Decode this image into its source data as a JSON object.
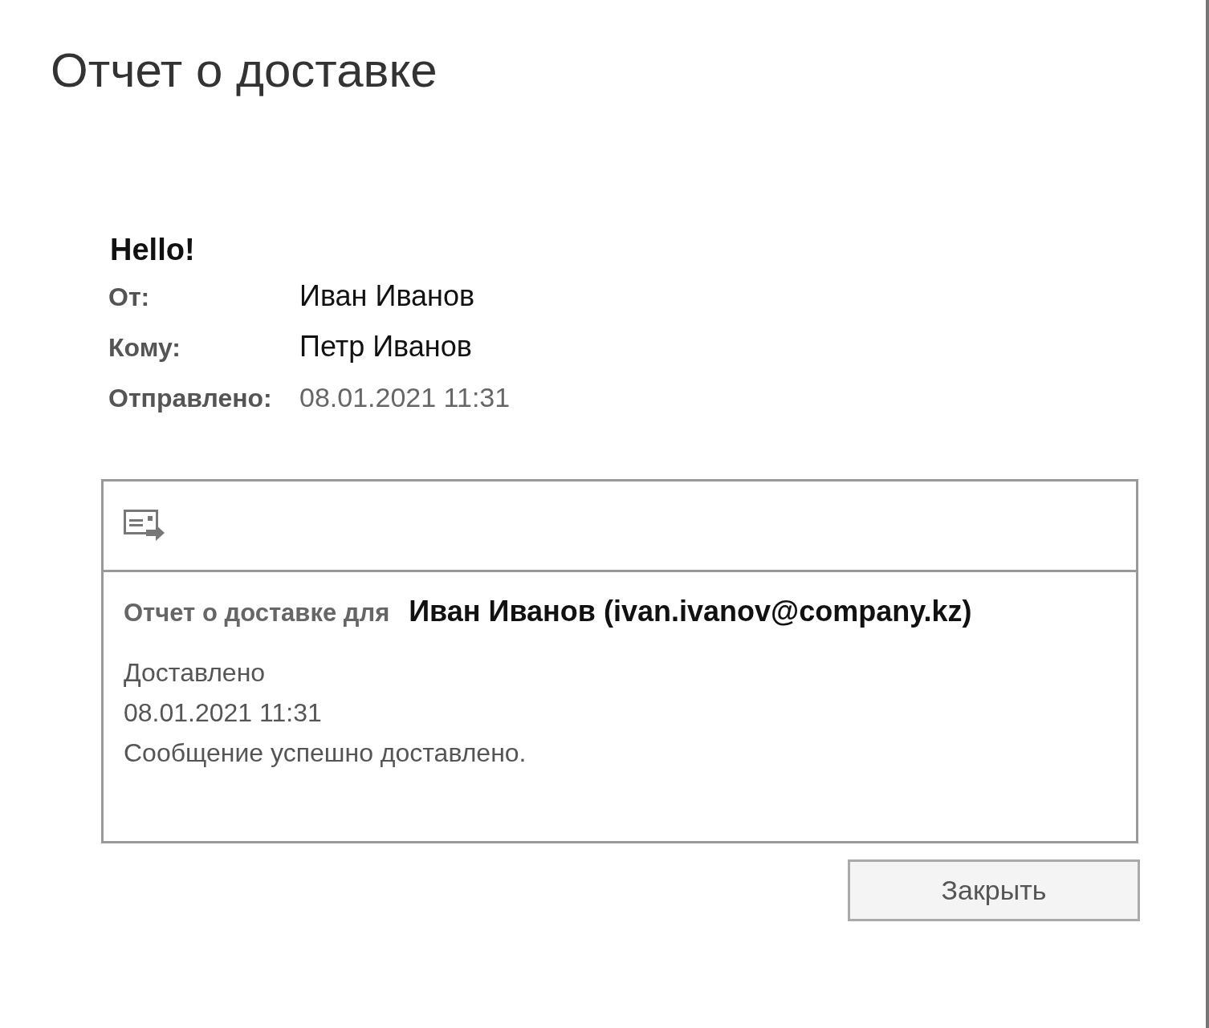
{
  "title": "Отчет о доставке",
  "message": {
    "subject": "Hello!",
    "fields": [
      {
        "label": "От:",
        "value": "Иван Иванов",
        "kind": "person"
      },
      {
        "label": "Кому:",
        "value": "Петр Иванов",
        "kind": "person"
      },
      {
        "label": "Отправлено:",
        "value": "08.01.2021 11:31",
        "kind": "date"
      }
    ]
  },
  "report": {
    "label": "Отчет о доставке для",
    "recipient": "Иван Иванов (ivan.ivanov@company.kz)",
    "lines": [
      "Доставлено",
      "08.01.2021 11:31",
      "Сообщение успешно доставлено."
    ]
  },
  "buttons": [
    "Закрыть"
  ]
}
